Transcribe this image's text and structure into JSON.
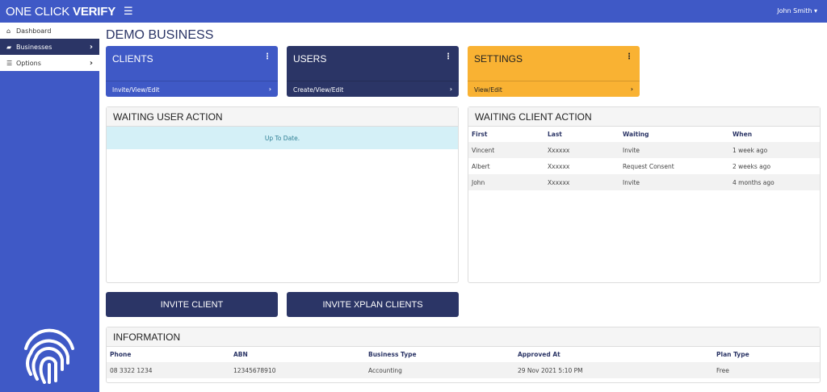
{
  "header": {
    "brand_light": "ONE CLICK ",
    "brand_bold": "VERIFY",
    "user": "John Smith ▾"
  },
  "sidebar": {
    "items": [
      {
        "label": "Dashboard",
        "icon": "home-icon"
      },
      {
        "label": "Businesses",
        "icon": "briefcase-icon"
      },
      {
        "label": "Options",
        "icon": "sliders-icon"
      }
    ]
  },
  "page": {
    "title": "DEMO BUSINESS"
  },
  "tiles": [
    {
      "title": "CLIENTS",
      "link": "Invite/View/Edit",
      "color": "#3f59c6"
    },
    {
      "title": "USERS",
      "link": "Create/View/Edit",
      "color": "#2b3566"
    },
    {
      "title": "SETTINGS",
      "link": "View/Edit",
      "color": "#f9b233"
    }
  ],
  "waiting_user": {
    "title": "WAITING USER ACTION",
    "status": "Up To Date."
  },
  "waiting_client": {
    "title": "WAITING CLIENT ACTION",
    "columns": [
      "First",
      "Last",
      "Waiting",
      "When"
    ],
    "rows": [
      [
        "Vincent",
        "Xxxxxx",
        "Invite",
        "1 week ago"
      ],
      [
        "Albert",
        "Xxxxxx",
        "Request Consent",
        "2 weeks ago"
      ],
      [
        "John",
        "Xxxxxx",
        "Invite",
        "4 months ago"
      ]
    ]
  },
  "buttons": {
    "invite_client": "INVITE CLIENT",
    "invite_xplan": "INVITE XPLAN CLIENTS"
  },
  "information": {
    "title": "INFORMATION",
    "columns": [
      "Phone",
      "ABN",
      "Business Type",
      "Approved At",
      "Plan Type"
    ],
    "values": [
      "08 3322 1234",
      "12345678910",
      "Accounting",
      "29 Nov 2021 5:10 PM",
      "Free"
    ]
  }
}
